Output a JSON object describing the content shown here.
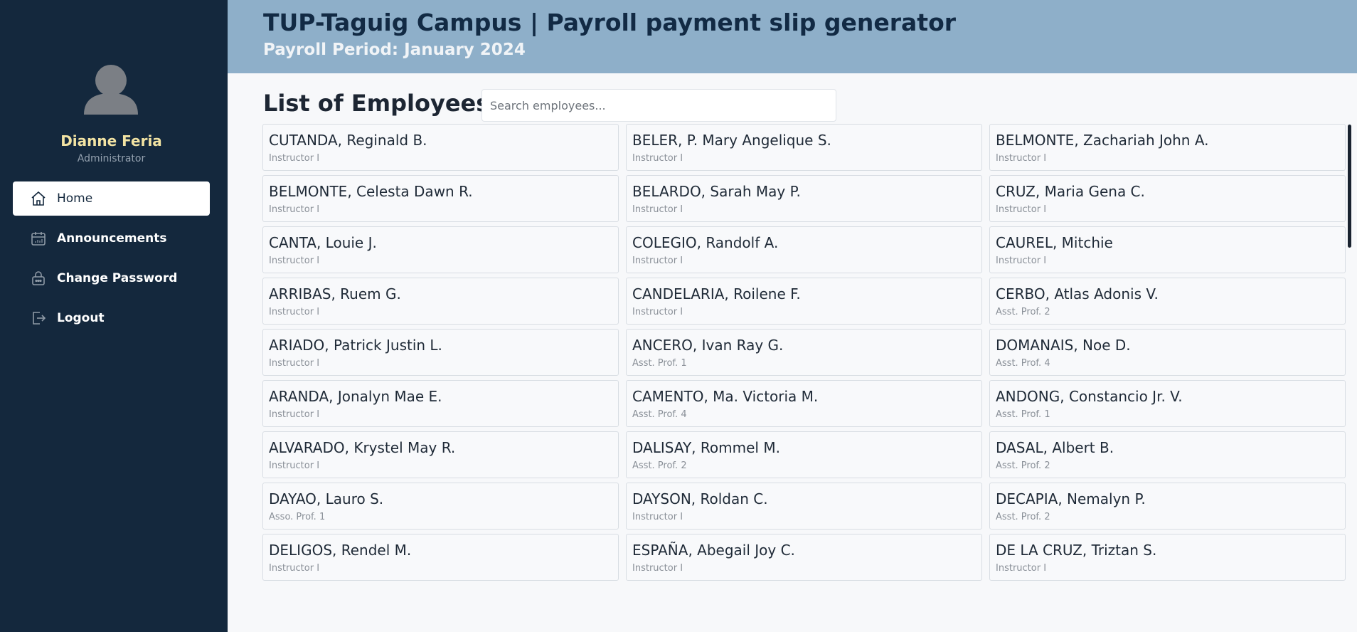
{
  "user": {
    "name": "Dianne Feria",
    "role": "Administrator"
  },
  "nav": [
    {
      "label": "Home",
      "icon": "home-icon",
      "active": true
    },
    {
      "label": "Announcements",
      "icon": "calendar-icon",
      "active": false
    },
    {
      "label": "Change Password",
      "icon": "lock-icon",
      "active": false
    },
    {
      "label": "Logout",
      "icon": "logout-icon",
      "active": false
    }
  ],
  "header": {
    "title": "TUP-Taguig Campus | Payroll payment slip generator",
    "subtitle": "Payroll Period: January 2024"
  },
  "main": {
    "title": "List of Employees",
    "search_placeholder": "Search employees..."
  },
  "colors": {
    "sidebar_bg": "#14283d",
    "header_bg": "#8eafc9",
    "name_accent": "#f2e3a3",
    "page_bg": "#f7f8fa"
  },
  "employees": [
    {
      "name": "CUTANDA, Reginald B.",
      "position": "Instructor I"
    },
    {
      "name": "BELER, P. Mary Angelique S.",
      "position": "Instructor I"
    },
    {
      "name": "BELMONTE, Zachariah John A.",
      "position": "Instructor I"
    },
    {
      "name": "BELMONTE, Celesta Dawn R.",
      "position": "Instructor I"
    },
    {
      "name": "BELARDO, Sarah May P.",
      "position": "Instructor I"
    },
    {
      "name": "CRUZ, Maria Gena C.",
      "position": "Instructor I"
    },
    {
      "name": "CANTA, Louie J.",
      "position": "Instructor I"
    },
    {
      "name": "COLEGIO, Randolf A.",
      "position": "Instructor I"
    },
    {
      "name": "CAUREL, Mitchie",
      "position": "Instructor I"
    },
    {
      "name": "ARRIBAS, Ruem G.",
      "position": "Instructor I"
    },
    {
      "name": "CANDELARIA, Roilene F.",
      "position": "Instructor I"
    },
    {
      "name": "CERBO, Atlas Adonis V.",
      "position": "Asst. Prof. 2"
    },
    {
      "name": "ARIADO, Patrick Justin L.",
      "position": "Instructor I"
    },
    {
      "name": "ANCERO, Ivan Ray G.",
      "position": "Asst. Prof. 1"
    },
    {
      "name": "DOMANAIS, Noe D.",
      "position": "Asst. Prof. 4"
    },
    {
      "name": "ARANDA, Jonalyn Mae E.",
      "position": "Instructor I"
    },
    {
      "name": "CAMENTO, Ma. Victoria M.",
      "position": "Asst. Prof. 4"
    },
    {
      "name": "ANDONG, Constancio Jr. V.",
      "position": "Asst. Prof. 1"
    },
    {
      "name": "ALVARADO, Krystel May R.",
      "position": "Instructor I"
    },
    {
      "name": "DALISAY, Rommel M.",
      "position": "Asst. Prof. 2"
    },
    {
      "name": "DASAL, Albert B.",
      "position": "Asst. Prof. 2"
    },
    {
      "name": "DAYAO, Lauro S.",
      "position": "Asso. Prof. 1"
    },
    {
      "name": "DAYSON, Roldan C.",
      "position": "Instructor I"
    },
    {
      "name": "DECAPIA, Nemalyn P.",
      "position": "Asst. Prof. 2"
    },
    {
      "name": "DELIGOS, Rendel M.",
      "position": "Instructor I"
    },
    {
      "name": "ESPAÑA, Abegail Joy C.",
      "position": "Instructor I"
    },
    {
      "name": "DE LA CRUZ, Triztan S.",
      "position": "Instructor I"
    },
    {
      "name": "",
      "position": ""
    },
    {
      "name": "",
      "position": ""
    },
    {
      "name": "",
      "position": ""
    }
  ]
}
